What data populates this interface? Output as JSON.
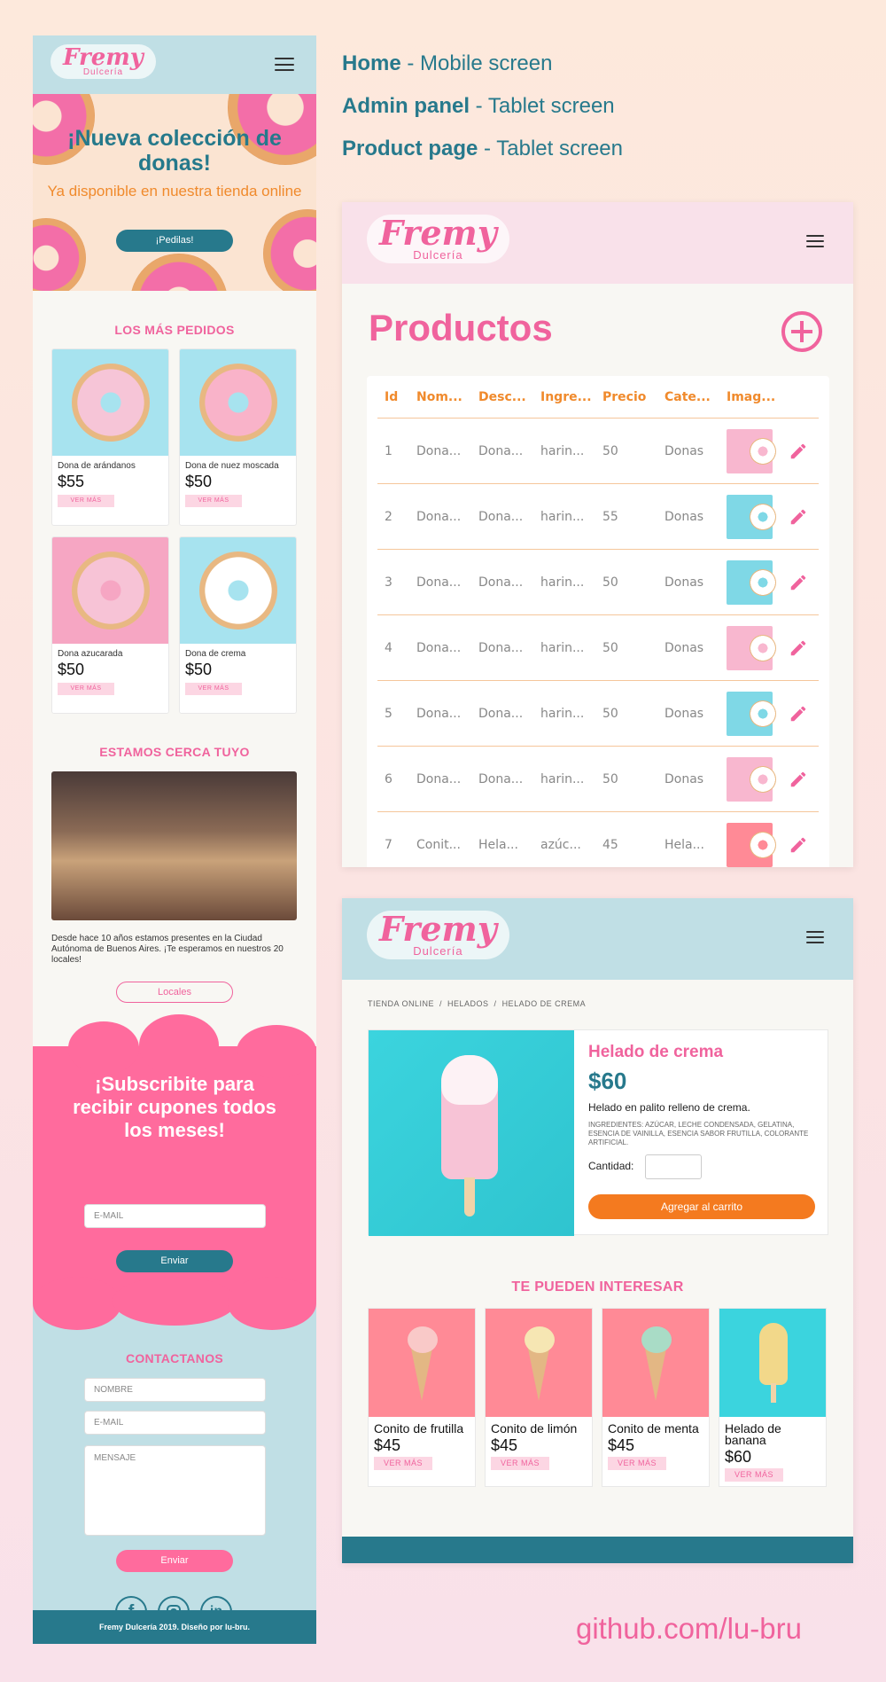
{
  "labels": [
    {
      "bold": "Home",
      "rest": " - Mobile screen"
    },
    {
      "bold": "Admin panel",
      "rest": " - Tablet screen"
    },
    {
      "bold": "Product page",
      "rest": " - Tablet screen"
    }
  ],
  "brand": {
    "name": "Fremy",
    "sub": "Dulcería"
  },
  "mobile": {
    "hero_title": "¡Nueva colección de donas!",
    "hero_sub": "Ya disponible en nuestra tienda online",
    "hero_btn": "¡Pedilas!",
    "popular_title": "LOS MÁS PEDIDOS",
    "products": [
      {
        "name": "Dona de arándanos",
        "price": "$55",
        "btn": "VER MÁS"
      },
      {
        "name": "Dona de nuez moscada",
        "price": "$50",
        "btn": "VER MÁS"
      },
      {
        "name": "Dona azucarada",
        "price": "$50",
        "btn": "VER MÁS"
      },
      {
        "name": "Dona de crema",
        "price": "$50",
        "btn": "VER MÁS"
      }
    ],
    "near_title": "ESTAMOS CERCA TUYO",
    "near_text": "Desde hace 10 años estamos presentes en la Ciudad Autónoma de Buenos Aires. ¡Te esperamos en nuestros 20 locales!",
    "near_btn": "Locales",
    "subscribe_title": "¡Subscribite para recibir cupones todos los meses!",
    "subscribe_placeholder": "E-MAIL",
    "subscribe_btn": "Enviar",
    "contact_title": "CONTACTANOS",
    "contact_name": "NOMBRE",
    "contact_email": "E-MAIL",
    "contact_msg": "MENSAJE",
    "contact_btn": "Enviar",
    "footer": "Fremy Dulcería 2019. Diseño por lu-bru."
  },
  "admin": {
    "title": "Productos",
    "headers": [
      "Id",
      "Nom...",
      "Desc...",
      "Ingre...",
      "Precio",
      "Cate...",
      "Imag..."
    ],
    "rows": [
      {
        "id": "1",
        "nom": "Dona...",
        "desc": "Dona...",
        "ing": "harin...",
        "precio": "50",
        "cat": "Donas",
        "bg": "#f8b7cf"
      },
      {
        "id": "2",
        "nom": "Dona...",
        "desc": "Dona...",
        "ing": "harin...",
        "precio": "55",
        "cat": "Donas",
        "bg": "#7fd8e6"
      },
      {
        "id": "3",
        "nom": "Dona...",
        "desc": "Dona...",
        "ing": "harin...",
        "precio": "50",
        "cat": "Donas",
        "bg": "#7fd8e6"
      },
      {
        "id": "4",
        "nom": "Dona...",
        "desc": "Dona...",
        "ing": "harin...",
        "precio": "50",
        "cat": "Donas",
        "bg": "#f8b7cf"
      },
      {
        "id": "5",
        "nom": "Dona...",
        "desc": "Dona...",
        "ing": "harin...",
        "precio": "50",
        "cat": "Donas",
        "bg": "#7fd8e6"
      },
      {
        "id": "6",
        "nom": "Dona...",
        "desc": "Dona...",
        "ing": "harin...",
        "precio": "50",
        "cat": "Donas",
        "bg": "#f8b7cf"
      },
      {
        "id": "7",
        "nom": "Conit...",
        "desc": "Hela...",
        "ing": "azúc...",
        "precio": "45",
        "cat": "Hela...",
        "bg": "#ff8a96"
      }
    ]
  },
  "product": {
    "breadcrumb": [
      "TIENDA ONLINE",
      "HELADOS",
      "HELADO DE CREMA"
    ],
    "name": "Helado de crema",
    "price": "$60",
    "desc": "Helado en palito relleno de crema.",
    "ingredients": "INGREDIENTES: AZÚCAR, LECHE CONDENSADA, GELATINA, ESENCIA DE VAINILLA, ESENCIA SABOR FRUTILLA, COLORANTE ARTIFICIAL.",
    "qty_label": "Cantidad:",
    "add_btn": "Agregar al carrito",
    "related_title": "TE PUEDEN INTERESAR",
    "related": [
      {
        "name": "Conito de frutilla",
        "price": "$45",
        "btn": "VER MÁS"
      },
      {
        "name": "Conito de limón",
        "price": "$45",
        "btn": "VER MÁS"
      },
      {
        "name": "Conito de menta",
        "price": "$45",
        "btn": "VER MÁS"
      },
      {
        "name": "Helado de banana",
        "price": "$60",
        "btn": "VER MÁS"
      }
    ]
  },
  "github": "github.com/lu-bru"
}
